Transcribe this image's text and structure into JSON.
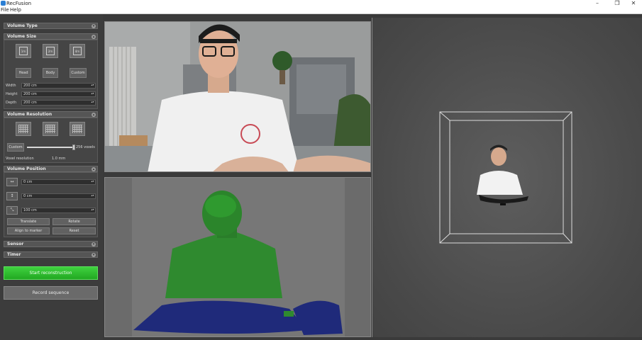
{
  "window": {
    "title": "RecFusion",
    "minimize": "–",
    "maximize": "❐",
    "close": "✕"
  },
  "menu": {
    "file": "File",
    "help": "Help"
  },
  "colors": {
    "start_button": "#2fbf2f",
    "depth_body": "#2f8a2f",
    "depth_hands": "#1f2a7a"
  },
  "sidebar": {
    "volume_type": {
      "title": "Volume Type"
    },
    "volume_size": {
      "title": "Volume Size",
      "presets": [
        "1m",
        "2m",
        "4m"
      ],
      "buttons": [
        "Head",
        "Body",
        "Custom"
      ],
      "fields": [
        {
          "label": "Width",
          "value": "200 cm"
        },
        {
          "label": "Height",
          "value": "200 cm"
        },
        {
          "label": "Depth",
          "value": "200 cm"
        }
      ]
    },
    "volume_resolution": {
      "title": "Volume Resolution",
      "custom_label": "Custom",
      "voxels_label": "256 voxels",
      "voxel_resolution_label": "Voxel resolution",
      "voxel_resolution_value": "1.0 mm",
      "slider_fraction": 1.0
    },
    "volume_position": {
      "title": "Volume Position",
      "fields": [
        "0 cm",
        "0 cm",
        "100 cm"
      ],
      "buttons": [
        "Translate",
        "Rotate",
        "Align to marker",
        "Reset"
      ]
    },
    "sensor": {
      "title": "Sensor"
    },
    "timer": {
      "title": "Timer"
    },
    "start_button": "Start reconstruction",
    "record_button": "Record sequence"
  }
}
